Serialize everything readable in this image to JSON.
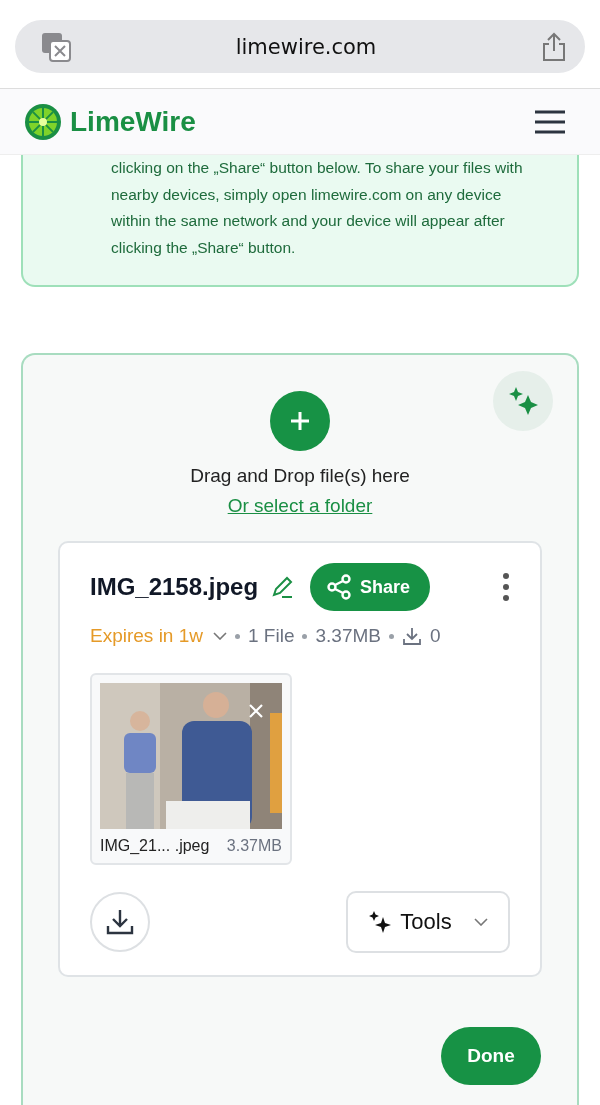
{
  "browser": {
    "url": "limewire.com"
  },
  "header": {
    "brand": "LimeWire"
  },
  "info": {
    "text": "clicking on the „Share“ button below. To share your files with nearby devices, simply open limewire.com on any device within the same network and your device will appear after clicking the „Share“ button."
  },
  "upload": {
    "drop_text": "Drag and Drop file(s) here",
    "folder_link": "Or select a folder",
    "file_card": {
      "name": "IMG_2158.jpeg",
      "share_label": "Share",
      "expiry": "Expires in 1w",
      "file_count": "1 File",
      "size": "3.37MB",
      "downloads": "0",
      "thumbnail": {
        "kind": "picture",
        "name": "IMG_21... .jpeg",
        "size": "3.37MB"
      },
      "tools_label": "Tools"
    },
    "done_label": "Done"
  }
}
